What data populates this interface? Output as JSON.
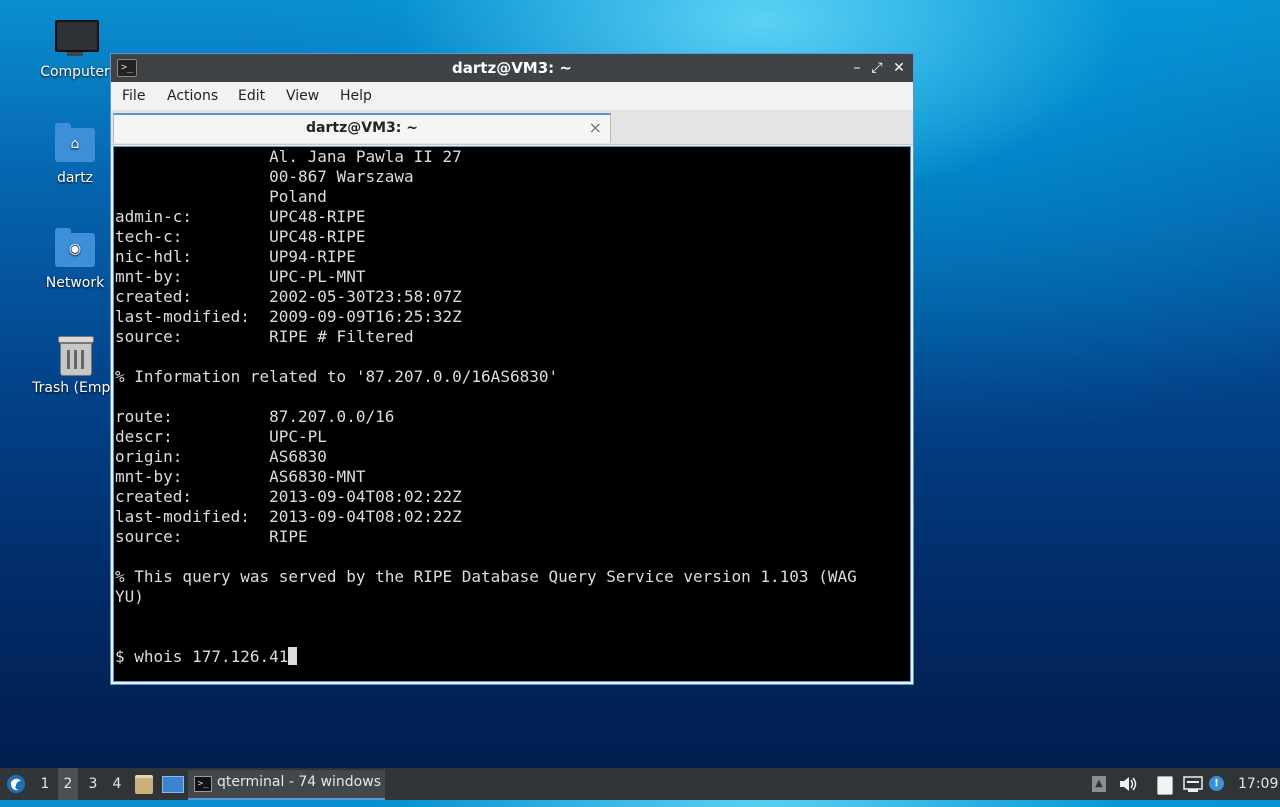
{
  "desktop": {
    "icons": [
      {
        "label": "Computer"
      },
      {
        "label": "dartz"
      },
      {
        "label": "Network"
      },
      {
        "label": "Trash (Empt"
      }
    ]
  },
  "window": {
    "title": "dartz@VM3: ~",
    "menu": [
      "File",
      "Actions",
      "Edit",
      "View",
      "Help"
    ],
    "tab": {
      "label": "dartz@VM3: ~",
      "close": "×"
    },
    "terminal_text": "                Al. Jana Pawla II 27\n                00-867 Warszawa\n                Poland\nadmin-c:        UPC48-RIPE\ntech-c:         UPC48-RIPE\nnic-hdl:        UP94-RIPE\nmnt-by:         UPC-PL-MNT\ncreated:        2002-05-30T23:58:07Z\nlast-modified:  2009-09-09T16:25:32Z\nsource:         RIPE # Filtered\n\n% Information related to '87.207.0.0/16AS6830'\n\nroute:          87.207.0.0/16\ndescr:          UPC-PL\norigin:         AS6830\nmnt-by:         AS6830-MNT\ncreated:        2013-09-04T08:02:22Z\nlast-modified:  2013-09-04T08:02:22Z\nsource:         RIPE\n\n% This query was served by the RIPE Database Query Service version 1.103 (WAG\nYU)\n\n\n",
    "prompt_line": "$ whois 177.126.41"
  },
  "taskbar": {
    "desktops": [
      "1",
      "2",
      "3",
      "4"
    ],
    "active_desktop": "2",
    "task_label": "qterminal - 74 windows",
    "clock": "17:09"
  },
  "colors": {
    "accent": "#5b96d6",
    "titlebar": "#3f4346",
    "taskbar": "#2f3437"
  }
}
